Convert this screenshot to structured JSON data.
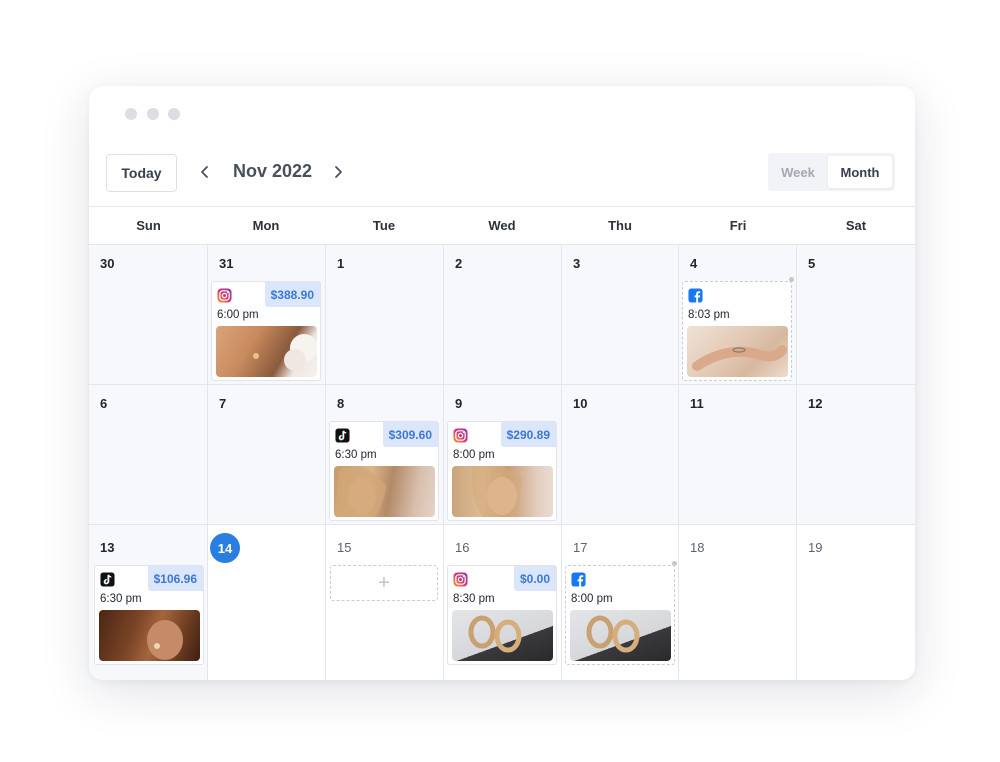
{
  "toolbar": {
    "today_label": "Today",
    "month_label": "Nov 2022",
    "view_week": "Week",
    "view_month": "Month",
    "active_view": "Month"
  },
  "weekdays": [
    "Sun",
    "Mon",
    "Tue",
    "Wed",
    "Thu",
    "Fri",
    "Sat"
  ],
  "calendar": {
    "today_date": "14",
    "colors": {
      "accent": "#2a7de1",
      "price_bg": "#dbe6fb",
      "price_text": "#3a78d8",
      "past_bg": "#f7f8fc"
    },
    "weeks": [
      [
        "30",
        "31",
        "1",
        "2",
        "3",
        "4",
        "5"
      ],
      [
        "6",
        "7",
        "8",
        "9",
        "10",
        "11",
        "12"
      ],
      [
        "13",
        "14",
        "15",
        "16",
        "17",
        "18",
        "19"
      ]
    ]
  },
  "posts": [
    {
      "date": "31",
      "platform": "instagram-icon",
      "price": "$388.90",
      "time": "6:00 pm",
      "image": "earring-portrait-with-flower",
      "style": "solid"
    },
    {
      "date": "4",
      "platform": "facebook-icon",
      "price": "",
      "time": "8:03 pm",
      "image": "hands-with-bracelet",
      "style": "dashed"
    },
    {
      "date": "8",
      "platform": "tiktok-icon",
      "price": "$309.60",
      "time": "6:30 pm",
      "image": "blonde-woman-profile",
      "style": "solid"
    },
    {
      "date": "9",
      "platform": "instagram-icon",
      "price": "$290.89",
      "time": "8:00 pm",
      "image": "woman-touching-earring",
      "style": "solid"
    },
    {
      "date": "13",
      "platform": "tiktok-icon",
      "price": "$106.96",
      "time": "6:30 pm",
      "image": "brunette-earring-closeup",
      "style": "solid"
    },
    {
      "date": "16",
      "platform": "instagram-icon",
      "price": "$0.00",
      "time": "8:30 pm",
      "image": "gold-hoop-earrings",
      "style": "solid"
    },
    {
      "date": "17",
      "platform": "facebook-icon",
      "price": "",
      "time": "8:00 pm",
      "image": "gold-hoop-earrings",
      "style": "dashed"
    }
  ],
  "add_slot": {
    "date": "15",
    "symbol": "+"
  }
}
